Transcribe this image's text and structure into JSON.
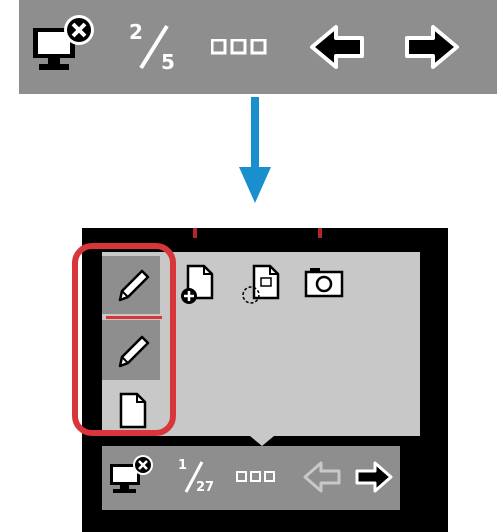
{
  "top_toolbar": {
    "icons": [
      "monitor-close-icon",
      "page-counter",
      "dots-icon",
      "arrow-left-icon",
      "arrow-right-icon"
    ],
    "page_current": "2",
    "page_total": "5"
  },
  "device": {
    "side_tools": [
      "pen-icon",
      "highlighter-icon",
      "blank-page-icon"
    ],
    "menu_icons": [
      "add-page-icon",
      "screenshot-page-icon",
      "camera-icon"
    ],
    "bottom_bar": {
      "page_current": "1",
      "page_total": "27"
    }
  },
  "colors": {
    "toolbar_gray": "#8e8e8e",
    "panel_gray": "#c8c8c8",
    "arrow_blue": "#1a8fd0",
    "highlight_red": "#d9363b"
  }
}
